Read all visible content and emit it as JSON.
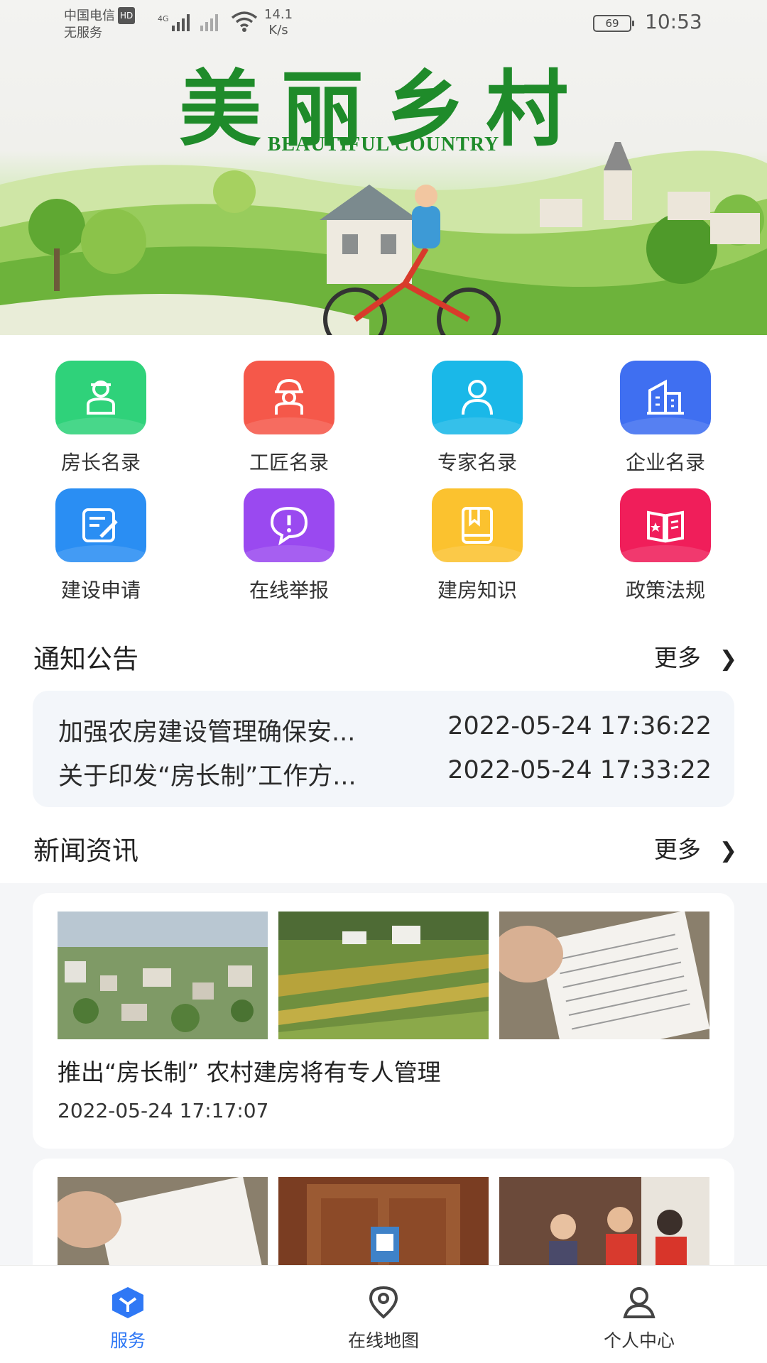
{
  "status_bar": {
    "carrier": "中国电信",
    "carrier_badge": "HD",
    "network_type": "4G",
    "service_status": "无服务",
    "speed_value": "14.1",
    "speed_unit": "K/s",
    "battery": "69",
    "time": "10:53"
  },
  "banner": {
    "title": "美丽乡村",
    "subtitle": "BEAUTIFUL COUNTRY"
  },
  "services": [
    {
      "label": "房长名录",
      "icon": "house-chief-icon",
      "color": "#2fd27a"
    },
    {
      "label": "工匠名录",
      "icon": "craftsman-icon",
      "color": "#f5584a"
    },
    {
      "label": "专家名录",
      "icon": "expert-icon",
      "color": "#1ab8e8"
    },
    {
      "label": "企业名录",
      "icon": "enterprise-icon",
      "color": "#3f6ff1"
    },
    {
      "label": "建设申请",
      "icon": "application-icon",
      "color": "#2a8ef3"
    },
    {
      "label": "在线举报",
      "icon": "report-icon",
      "color": "#9a49f0"
    },
    {
      "label": "建房知识",
      "icon": "knowledge-icon",
      "color": "#fbc22f"
    },
    {
      "label": "政策法规",
      "icon": "policy-icon",
      "color": "#f01e5a"
    }
  ],
  "notices": {
    "title": "通知公告",
    "more": "更多",
    "items": [
      {
        "title": "加强农房建设管理确保安...",
        "time": "2022-05-24 17:36:22"
      },
      {
        "title": "关于印发“房长制”工作方...",
        "time": "2022-05-24 17:33:22"
      }
    ]
  },
  "news": {
    "title": "新闻资讯",
    "more": "更多",
    "items": [
      {
        "title": "推出“房长制” 农村建房将有专人管理",
        "time": "2022-05-24 17:17:07"
      },
      {
        "title": "",
        "time": ""
      }
    ]
  },
  "bottom_nav": [
    {
      "label": "服务",
      "icon": "service-icon",
      "active": true
    },
    {
      "label": "在线地图",
      "icon": "map-pin-icon",
      "active": false
    },
    {
      "label": "个人中心",
      "icon": "profile-icon",
      "active": false
    }
  ],
  "colors": {
    "accent": "#2f78f5",
    "banner_green": "#1f8b2a"
  }
}
